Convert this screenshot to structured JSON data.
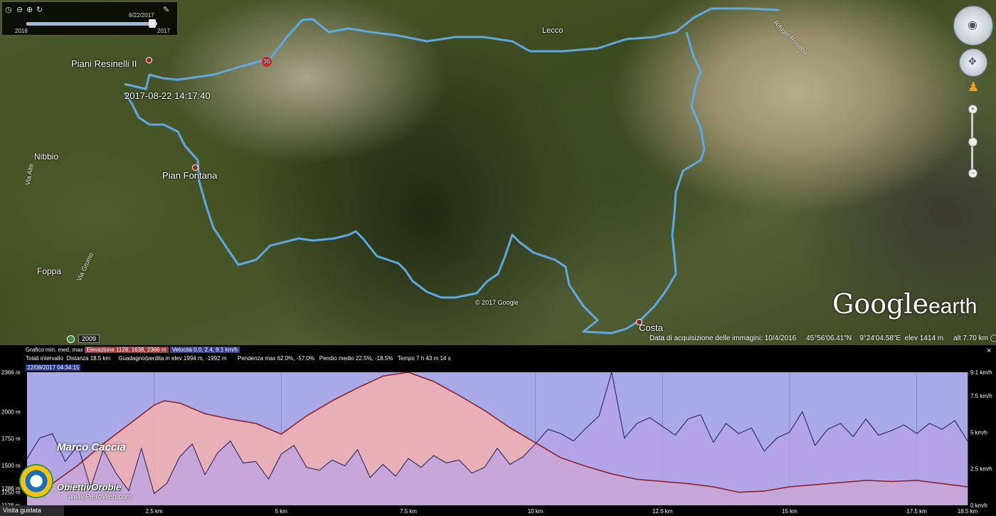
{
  "map": {
    "labels": {
      "piani_resinelli": "Piani Resinelli II",
      "timestamp": "2017-08-22 14:17:40",
      "nibbio": "Nibbio",
      "pian_fontana": "Pian Fontana",
      "foppa": "Foppa",
      "lecco": "Lecco",
      "costa": "Costa",
      "copyright": "© 2017 Google",
      "via_alte": "Via Alte",
      "via_grumo": "Via Grumo",
      "rifugio": "Rifugio Rosalba",
      "road_shield": "36"
    },
    "timeslider": {
      "date": "8/22/2017",
      "start": "2016",
      "end": "2017"
    },
    "year_badge": "2009",
    "logo": {
      "google": "Google",
      "earth": "earth"
    },
    "status": {
      "date": "Data di acquisizione delle immagini: 10/4/2016",
      "lat": "45°56'06.41\"N",
      "lon": "9°24'04.58\"E",
      "elev": "elev  1414 m",
      "alt": "alt   7.70 km"
    },
    "route_color": "#5fa8e0"
  },
  "profile": {
    "info_line1": {
      "prefix": "Grafico  min, med, max",
      "elevation": "Elevazione  1128, 1638, 2366 m",
      "speed": "Velocità  0.0, 2.4, 9.1 km/h"
    },
    "info_line2": {
      "totals": "Totali intervallo",
      "distance": "Distanza  18.5 km",
      "gain": "Guadagno/perdita in elev   1994 m, -1992 m",
      "slope_max": "Pendenza max  62.0%, -57.0%",
      "slope_mean": "Pendio medio  22.5%, -18.5%",
      "time": "Tempo  7 h 43 m 14 s"
    },
    "date_tag": "22/08/2017 04:34:15",
    "close": "×",
    "watermark": "Marco Caccia",
    "guided_tour": "Visita guidata",
    "logo_text": "ObiettivOrobie",
    "logo_url": "www.PieroWeb.com"
  },
  "chart_data": {
    "type": "area",
    "x_ticks": [
      {
        "v": 2.5,
        "label": "2.5 km"
      },
      {
        "v": 5,
        "label": "5 km"
      },
      {
        "v": 7.5,
        "label": "7.5 km"
      },
      {
        "v": 10,
        "label": "10 km"
      },
      {
        "v": 12.5,
        "label": "12.5 km"
      },
      {
        "v": 15,
        "label": "15 km"
      },
      {
        "v": 17.5,
        "label": "17.5 km"
      },
      {
        "v": 18.5,
        "label": "18.5 km"
      }
    ],
    "y_left_ticks": [
      {
        "v": 2366,
        "label": "2366 m"
      },
      {
        "v": 2000,
        "label": "2000 m"
      },
      {
        "v": 1750,
        "label": "1750 m"
      },
      {
        "v": 1500,
        "label": "1500 m"
      },
      {
        "v": 1286,
        "label": "1286 m"
      },
      {
        "v": 1250,
        "label": "1250 m"
      },
      {
        "v": 1128,
        "label": "1128 m"
      }
    ],
    "y_right_ticks": [
      {
        "v": 9.1,
        "label": "9.1 km/h"
      },
      {
        "v": 7.5,
        "label": "7.5 km/h"
      },
      {
        "v": 5,
        "label": "5 km/h"
      },
      {
        "v": 2.5,
        "label": "2.5 km/h"
      },
      {
        "v": 0,
        "label": "0 km/h"
      }
    ],
    "xlim": [
      0,
      18.5
    ],
    "ylim_left": [
      1128,
      2366
    ],
    "ylim_right": [
      0,
      9.1
    ],
    "elevation": {
      "name": "Elevazione",
      "color": "#8b1a1a",
      "fill": "#f4b0b0",
      "x": [
        0,
        0.5,
        1,
        1.5,
        2,
        2.5,
        2.7,
        3,
        3.5,
        4,
        4.5,
        5,
        5.5,
        6,
        6.5,
        7,
        7.5,
        8,
        8.5,
        9,
        9.5,
        10,
        10.5,
        11,
        11.5,
        12,
        12.5,
        13,
        13.5,
        14,
        14.5,
        15,
        15.5,
        16,
        16.5,
        17,
        17.5,
        18,
        18.5
      ],
      "values": [
        1270,
        1330,
        1500,
        1700,
        1880,
        2060,
        2100,
        2080,
        1980,
        1930,
        1890,
        1790,
        1960,
        2100,
        2220,
        2330,
        2366,
        2280,
        2150,
        2010,
        1850,
        1710,
        1570,
        1490,
        1420,
        1370,
        1350,
        1330,
        1300,
        1250,
        1260,
        1300,
        1320,
        1340,
        1360,
        1350,
        1360,
        1330,
        1300
      ]
    },
    "speed": {
      "name": "Velocità",
      "color": "#1b1b55",
      "fill": "#b7a3e6",
      "x": [
        0,
        0.25,
        0.5,
        0.75,
        1,
        1.25,
        1.5,
        1.75,
        2,
        2.25,
        2.5,
        2.75,
        3,
        3.25,
        3.5,
        3.75,
        4,
        4.25,
        4.5,
        4.75,
        5,
        5.25,
        5.5,
        5.75,
        6,
        6.25,
        6.5,
        6.75,
        7,
        7.25,
        7.5,
        7.75,
        8,
        8.25,
        8.5,
        8.75,
        9,
        9.25,
        9.5,
        9.75,
        10,
        10.25,
        10.5,
        10.75,
        11,
        11.25,
        11.5,
        11.75,
        12,
        12.25,
        12.5,
        12.75,
        13,
        13.25,
        13.5,
        13.75,
        14,
        14.25,
        14.5,
        14.75,
        15,
        15.25,
        15.5,
        15.75,
        16,
        16.25,
        16.5,
        16.75,
        17,
        17.25,
        17.5,
        17.75,
        18,
        18.25,
        18.5
      ],
      "values": [
        3.2,
        4.6,
        4.9,
        3.0,
        4.1,
        1.2,
        3.8,
        2.2,
        1.0,
        3.9,
        0.8,
        1.5,
        3.3,
        4.2,
        2.1,
        3.6,
        4.4,
        2.9,
        3.0,
        1.8,
        3.5,
        4.1,
        2.6,
        2.4,
        3.1,
        2.7,
        3.8,
        1.9,
        2.8,
        2.0,
        3.2,
        2.6,
        3.4,
        2.9,
        3.1,
        2.2,
        2.6,
        3.9,
        2.8,
        3.3,
        4.2,
        5.2,
        4.9,
        4.4,
        5.3,
        6.1,
        9.1,
        4.6,
        5.6,
        6.0,
        5.4,
        4.8,
        5.9,
        6.2,
        4.3,
        5.6,
        4.9,
        5.3,
        3.7,
        4.6,
        5.0,
        6.4,
        4.1,
        5.2,
        5.6,
        4.7,
        5.9,
        4.8,
        5.1,
        5.5,
        4.9,
        5.6,
        5.2,
        5.8,
        4.4
      ]
    }
  }
}
